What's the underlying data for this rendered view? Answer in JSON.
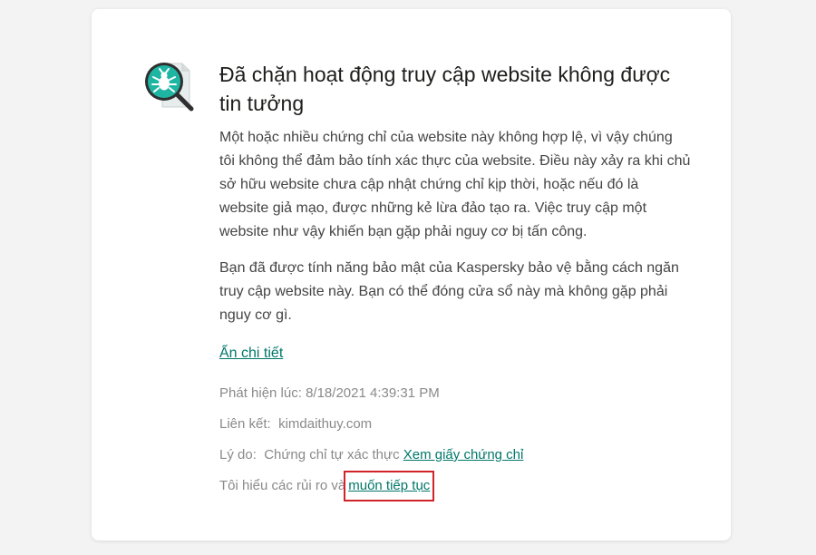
{
  "icons": {
    "alert": "bug-magnifier-icon"
  },
  "colors": {
    "accent": "#00776a",
    "highlight": "#d2232a"
  },
  "title": "Đã chặn hoạt động truy cập website không được tin tưởng",
  "paragraphs": [
    "Một hoặc nhiều chứng chỉ của website này không hợp lệ, vì vậy chúng tôi không thể đảm bảo tính xác thực của website. Điều này xảy ra khi chủ sở hữu website chưa cập nhật chứng chỉ kịp thời, hoặc nếu đó là website giả mạo, được những kẻ lừa đảo tạo ra. Việc truy cập một website như vậy khiến bạn gặp phải nguy cơ bị tấn công.",
    "Bạn đã được tính năng bảo mật của Kaspersky bảo vệ bằng cách ngăn truy cập website này. Bạn có thể đóng cửa sổ này mà không gặp phải nguy cơ gì."
  ],
  "toggle_details": "Ẩn chi tiết",
  "details": {
    "detected_label": "Phát hiện lúc:",
    "detected_value": "8/18/2021 4:39:31 PM",
    "link_label": "Liên kết:",
    "link_value": "kimdaithuy.com",
    "reason_label": "Lý do:",
    "reason_value": "Chứng chỉ tự xác thực",
    "view_cert": "Xem giấy chứng chỉ",
    "risk_text": "Tôi hiểu các rủi ro và",
    "continue": "muốn tiếp tục"
  }
}
